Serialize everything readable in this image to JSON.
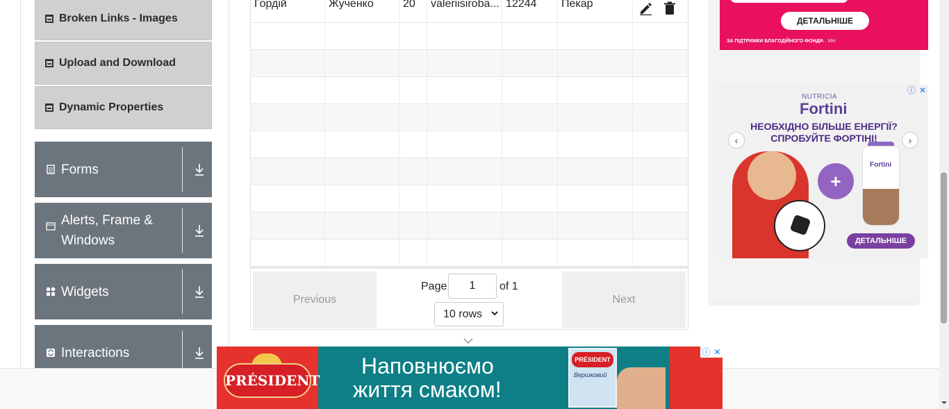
{
  "sidebar": {
    "sub_items": [
      "Broken Links - Images",
      "Upload and Download",
      "Dynamic Properties"
    ],
    "groups": [
      {
        "label": "Forms",
        "icon": "form-icon"
      },
      {
        "label": "Alerts, Frame & Windows",
        "icon": "window-icon"
      },
      {
        "label": "Widgets",
        "icon": "widgets-icon"
      },
      {
        "label": "Interactions",
        "icon": "interactions-icon"
      }
    ]
  },
  "table": {
    "first_row": {
      "first_name": "Гордій",
      "last_name": "Жученко",
      "age": "20",
      "email": "valeriisiroba...",
      "salary": "12244",
      "department": "Пекар"
    },
    "actions": [
      "edit-icon",
      "delete-icon"
    ]
  },
  "pagination": {
    "previous_label": "Previous",
    "next_label": "Next",
    "page_label": "Page",
    "page_value": "1",
    "of_label": "of 1",
    "rows_option": "10 rows"
  },
  "ads": {
    "pink_top": {
      "cta": "ДЕТАЛЬНІШЕ",
      "footer": "ЗА ПІДТРИМКИ БЛАГОДІЙНОГО ФОНДУ",
      "footer_mark": "UA · MH"
    },
    "nutricia": {
      "brand_small": "NUTRICIA",
      "brand": "Fortini",
      "headline_1": "НЕОБХІДНО БІЛЬШЕ ЕНЕРГІЇ?",
      "headline_2": "СПРОБУЙТЕ ФОРТІНІ!",
      "bottle_label": "Fortini",
      "cta": "ДЕТАЛЬНІШЕ"
    },
    "bottom_banner": {
      "logo": "PRÉSIDENT",
      "line_1": "Наповнюємо",
      "line_2": "життя смаком!",
      "pack_brand": "PRÉSIDENT",
      "pack_product": "Вершковий"
    }
  },
  "colors": {
    "sidebar_group": "#6c757d",
    "sidebar_sub": "#d0d0d0",
    "pink_ad": "#e9105e",
    "president_red": "#e5322d",
    "president_teal": "#0e7f86"
  }
}
